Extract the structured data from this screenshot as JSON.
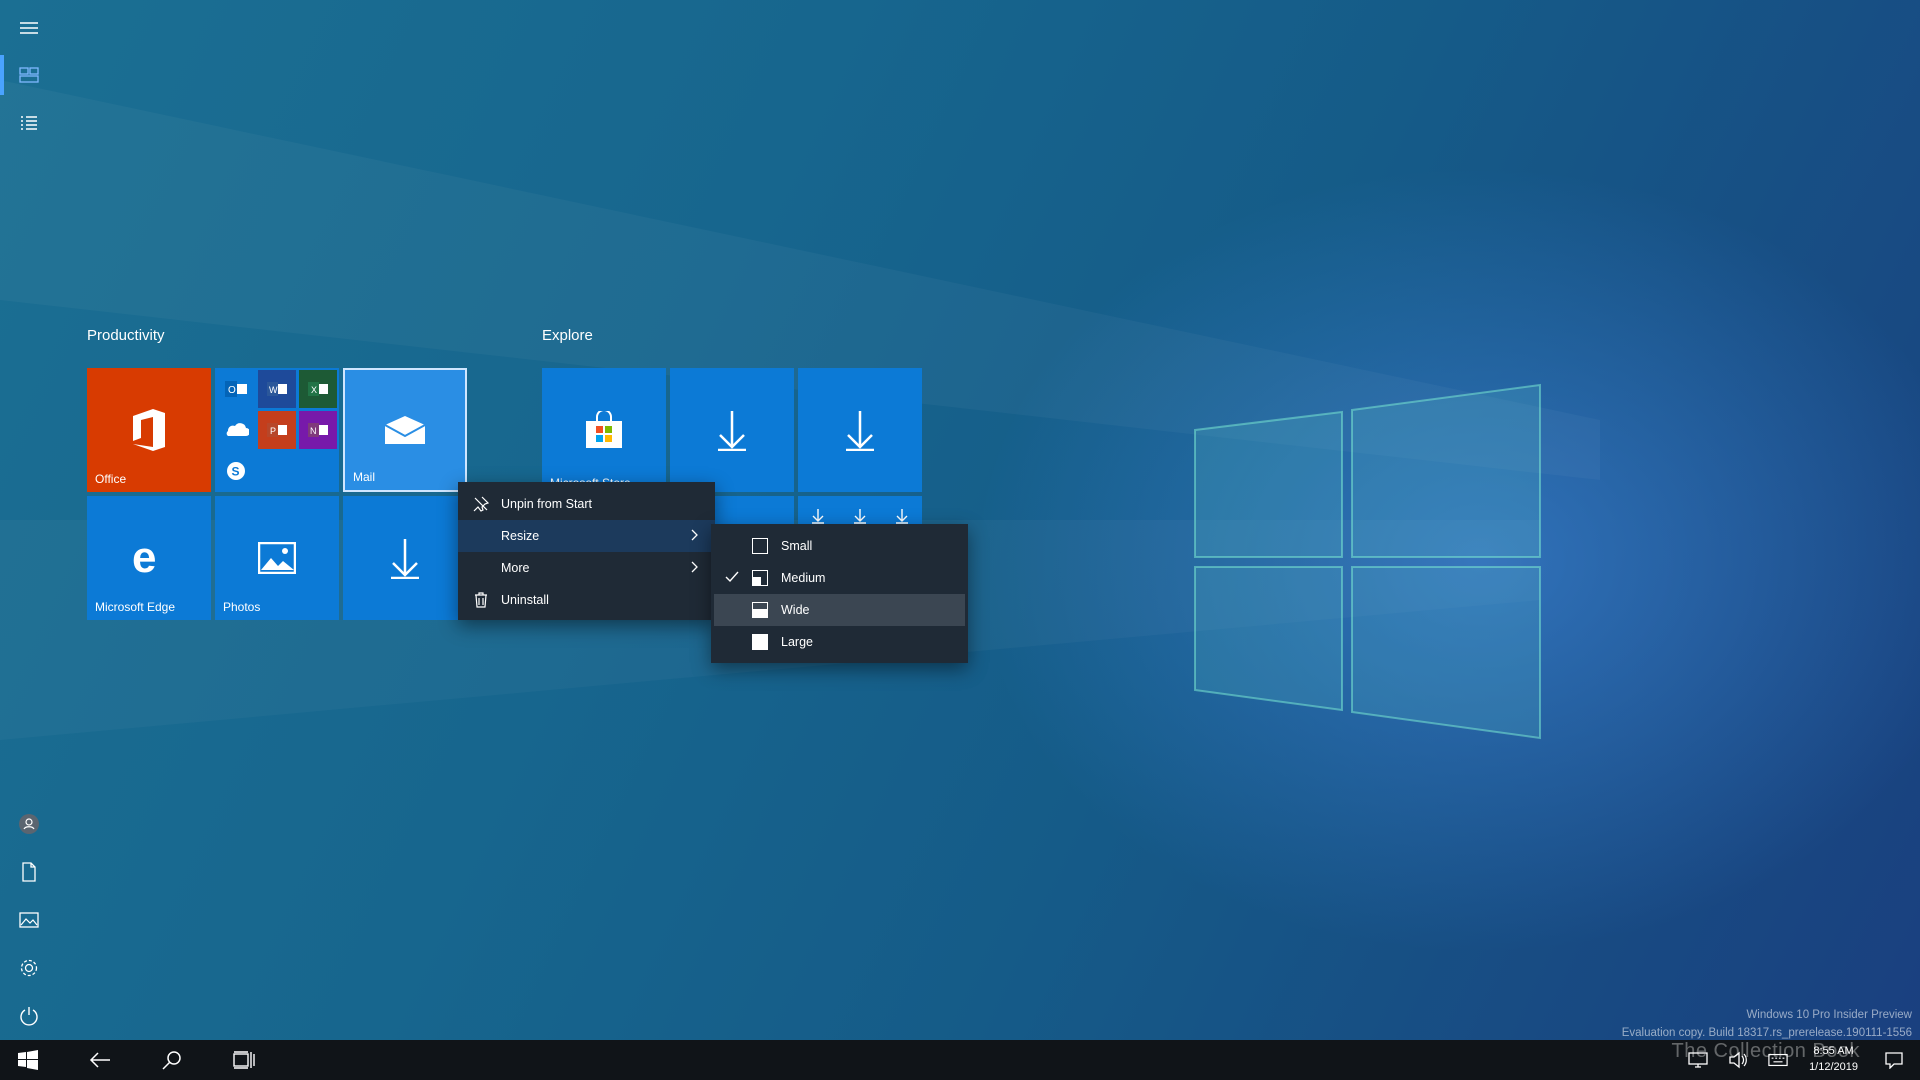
{
  "rail": {
    "items": [
      {
        "name": "hamburger-icon"
      },
      {
        "name": "pinned-tiles-icon",
        "active": true
      },
      {
        "name": "all-apps-list-icon"
      }
    ],
    "bottom": [
      {
        "name": "user-avatar-icon"
      },
      {
        "name": "documents-icon"
      },
      {
        "name": "pictures-icon"
      },
      {
        "name": "settings-gear-icon"
      },
      {
        "name": "power-icon"
      }
    ]
  },
  "groups": {
    "productivity": {
      "title": "Productivity",
      "tiles": {
        "office": "Office",
        "mail": "Mail",
        "edge": "Microsoft Edge",
        "photos": "Photos"
      }
    },
    "explore": {
      "title": "Explore",
      "tiles": {
        "store": "Microsoft Store"
      }
    }
  },
  "context_menu": {
    "items": [
      {
        "label": "Unpin from Start",
        "icon": "unpin-icon"
      },
      {
        "label": "Resize",
        "has_submenu": true,
        "highlighted": true
      },
      {
        "label": "More",
        "has_submenu": true
      },
      {
        "label": "Uninstall",
        "icon": "trash-icon"
      }
    ],
    "resize_submenu": {
      "items": [
        {
          "label": "Small",
          "checked": false
        },
        {
          "label": "Medium",
          "checked": true
        },
        {
          "label": "Wide",
          "checked": false,
          "hovered": true
        },
        {
          "label": "Large",
          "checked": false
        }
      ]
    }
  },
  "watermark": {
    "line1": "Windows 10 Pro Insider Preview",
    "line2": "Evaluation copy. Build 18317.rs_prerelease.190111-1556"
  },
  "taskbar": {
    "time": "8:55 AM",
    "date": "1/12/2019"
  },
  "brand_overlay": "The Collection Book",
  "colors": {
    "tile_blue": "#0c7ad6",
    "office_orange": "#d83b01",
    "menu_bg": "#1f2a36",
    "taskbar": "#101418"
  }
}
